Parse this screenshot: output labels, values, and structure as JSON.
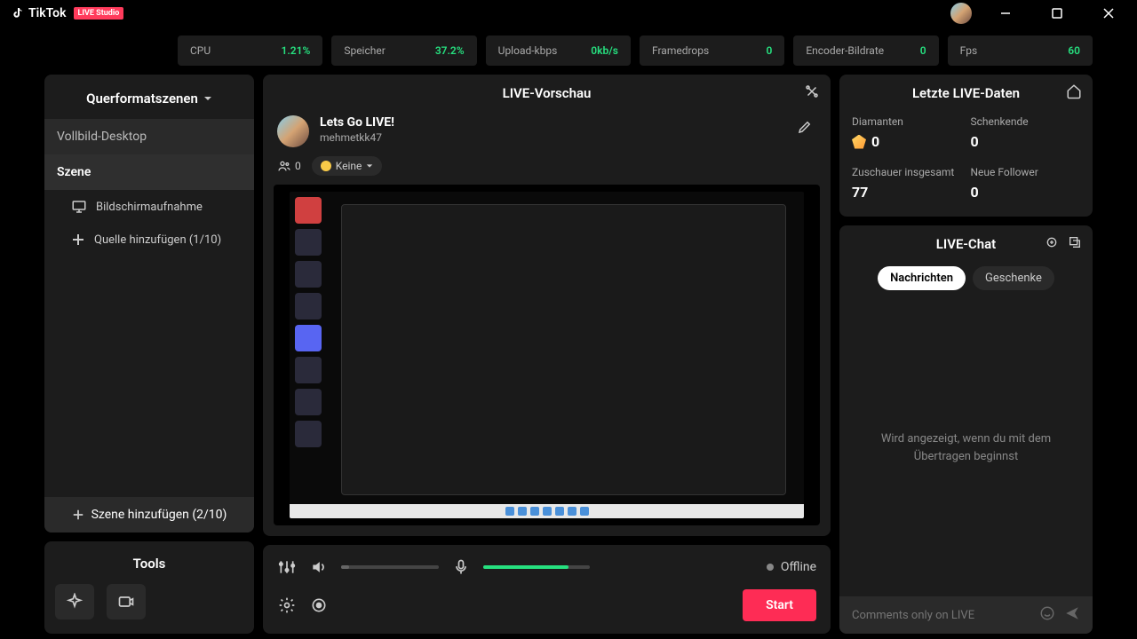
{
  "app": {
    "name": "TikTok",
    "badge": "LIVE Studio"
  },
  "stats": {
    "cpu_label": "CPU",
    "cpu_value": "1.21%",
    "mem_label": "Speicher",
    "mem_value": "37.2%",
    "upload_label": "Upload-kbps",
    "upload_value": "0kb/s",
    "framedrops_label": "Framedrops",
    "framedrops_value": "0",
    "encoder_label": "Encoder-Bildrate",
    "encoder_value": "0",
    "fps_label": "Fps",
    "fps_value": "60"
  },
  "scenes": {
    "header": "Querformatszenen",
    "fullscreen": "Vollbild-Desktop",
    "selected": "Szene",
    "source_screen": "Bildschirmaufnahme",
    "add_source": "Quelle hinzufügen (1/10)",
    "add_scene": "Szene hinzufügen (2/10)"
  },
  "tools": {
    "title": "Tools"
  },
  "preview": {
    "title": "LIVE-Vorschau",
    "stream_title": "Lets Go LIVE!",
    "stream_user": "mehmetkk47",
    "viewers": "0",
    "category": "Keine"
  },
  "controls": {
    "status": "Offline",
    "start": "Start"
  },
  "stats_panel": {
    "title": "Letzte LIVE-Daten",
    "diamonds_label": "Diamanten",
    "diamonds_value": "0",
    "gifters_label": "Schenkende",
    "gifters_value": "0",
    "viewers_label": "Zuschauer insgesamt",
    "viewers_value": "77",
    "followers_label": "Neue Follower",
    "followers_value": "0"
  },
  "chat": {
    "title": "LIVE-Chat",
    "tab_messages": "Nachrichten",
    "tab_gifts": "Geschenke",
    "empty": "Wird angezeigt, wenn du mit dem Übertragen beginnst",
    "input_placeholder": "Comments only on LIVE"
  }
}
